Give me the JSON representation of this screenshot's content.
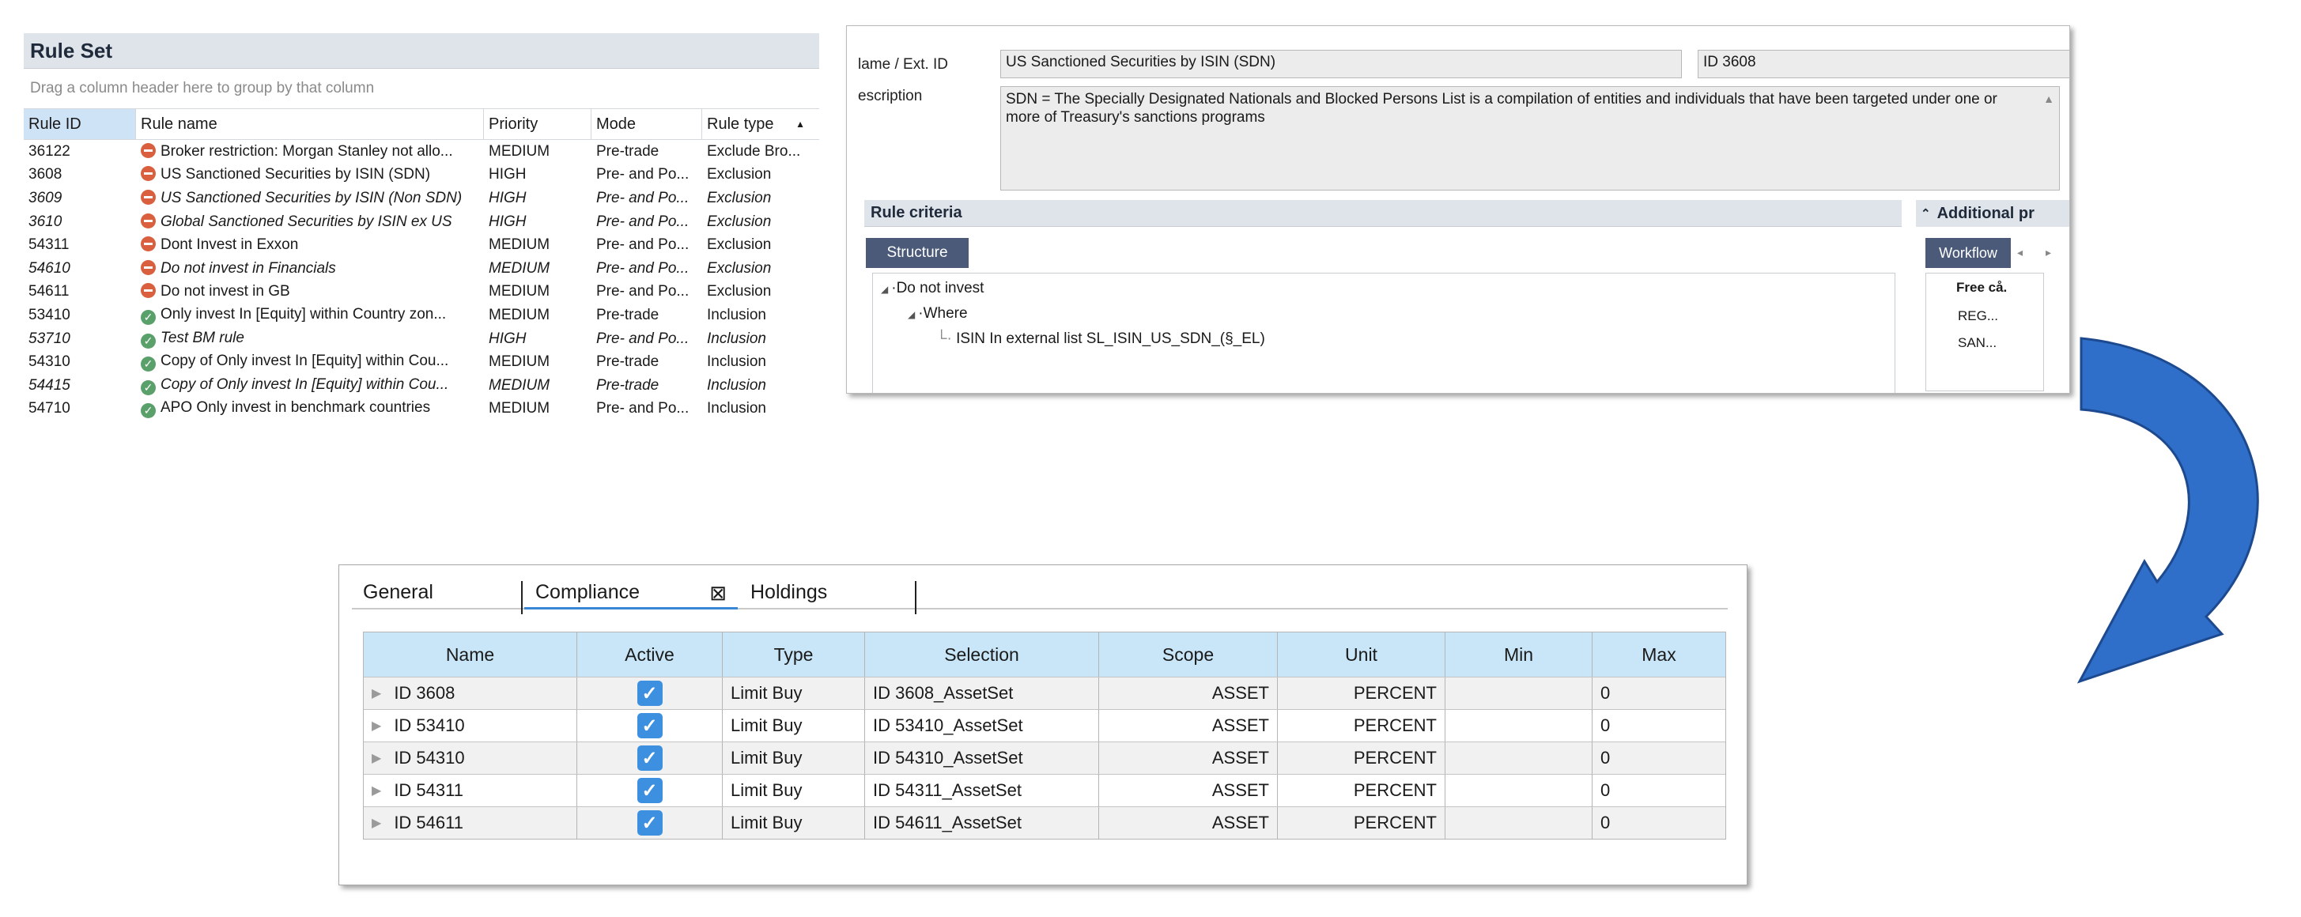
{
  "rule_set": {
    "title": "Rule Set",
    "group_hint": "Drag a column header here to group by that column",
    "columns": [
      "Rule ID",
      "Rule name",
      "Priority",
      "Mode",
      "Rule type"
    ],
    "rows": [
      {
        "id": "36122",
        "name": "Broker restriction: Morgan Stanley not allo...",
        "priority": "MEDIUM",
        "mode": "Pre-trade",
        "type": "Exclude Bro...",
        "status": "exclude"
      },
      {
        "id": "3608",
        "name": "US Sanctioned Securities by ISIN (SDN)",
        "priority": "HIGH",
        "mode": "Pre- and Po...",
        "type": "Exclusion",
        "status": "exclude"
      },
      {
        "id": "3609",
        "name": "US Sanctioned Securities by ISIN (Non SDN)",
        "priority": "HIGH",
        "mode": "Pre- and Po...",
        "type": "Exclusion",
        "status": "exclude"
      },
      {
        "id": "3610",
        "name": "Global Sanctioned Securities by ISIN ex US",
        "priority": "HIGH",
        "mode": "Pre- and Po...",
        "type": "Exclusion",
        "status": "exclude"
      },
      {
        "id": "54311",
        "name": "Dont Invest in Exxon",
        "priority": "MEDIUM",
        "mode": "Pre- and Po...",
        "type": "Exclusion",
        "status": "exclude"
      },
      {
        "id": "54610",
        "name": "Do not invest in Financials",
        "priority": "MEDIUM",
        "mode": "Pre- and Po...",
        "type": "Exclusion",
        "status": "exclude"
      },
      {
        "id": "54611",
        "name": "Do not invest in GB",
        "priority": "MEDIUM",
        "mode": "Pre- and Po...",
        "type": "Exclusion",
        "status": "exclude"
      },
      {
        "id": "53410",
        "name": "Only invest In [Equity] within Country zon...",
        "priority": "MEDIUM",
        "mode": "Pre-trade",
        "type": "Inclusion",
        "status": "include"
      },
      {
        "id": "53710",
        "name": "Test BM rule",
        "priority": "HIGH",
        "mode": "Pre- and Po...",
        "type": "Inclusion",
        "status": "include"
      },
      {
        "id": "54310",
        "name": "Copy of Only invest In [Equity] within Cou...",
        "priority": "MEDIUM",
        "mode": "Pre-trade",
        "type": "Inclusion",
        "status": "include"
      },
      {
        "id": "54415",
        "name": "Copy of Only invest In [Equity] within Cou...",
        "priority": "MEDIUM",
        "mode": "Pre-trade",
        "type": "Inclusion",
        "status": "include"
      },
      {
        "id": "54710",
        "name": "APO Only invest in benchmark countries",
        "priority": "MEDIUM",
        "mode": "Pre- and Po...",
        "type": "Inclusion",
        "status": "include"
      }
    ]
  },
  "rule_detail": {
    "name_label": "lame / Ext. ID",
    "name_value": "US Sanctioned Securities by ISIN (SDN)",
    "ext_id_value": "ID 3608",
    "description_label": "escription",
    "description_value": "SDN = The Specially Designated Nationals and Blocked Persons List is a compilation of entities and individuals that have been targeted under one or more of Treasury's sanctions programs",
    "criteria_title": "Rule criteria",
    "structure_tab": "Structure",
    "tree": [
      "Do not invest",
      "Where",
      "ISIN In external list SL_ISIN_US_SDN_(§_EL)"
    ],
    "additional_title": "Additional pr",
    "workflow_tab": "Workflow",
    "free_col_header": "Free cå.",
    "free_col_values": [
      "REG...",
      "SAN..."
    ]
  },
  "compliance": {
    "tabs": [
      "General",
      "Compliance",
      "Holdings"
    ],
    "active_tab": "Compliance",
    "columns": [
      "Name",
      "Active",
      "Type",
      "Selection",
      "Scope",
      "Unit",
      "Min",
      "Max"
    ],
    "rows": [
      {
        "name": "ID 3608",
        "active": true,
        "type": "Limit Buy",
        "selection": "ID 3608_AssetSet",
        "scope": "ASSET",
        "unit": "PERCENT",
        "min": "",
        "max": "0"
      },
      {
        "name": "ID 53410",
        "active": true,
        "type": "Limit Buy",
        "selection": "ID 53410_AssetSet",
        "scope": "ASSET",
        "unit": "PERCENT",
        "min": "",
        "max": "0"
      },
      {
        "name": "ID 54310",
        "active": true,
        "type": "Limit Buy",
        "selection": "ID 54310_AssetSet",
        "scope": "ASSET",
        "unit": "PERCENT",
        "min": "",
        "max": "0"
      },
      {
        "name": "ID 54311",
        "active": true,
        "type": "Limit Buy",
        "selection": "ID 54311_AssetSet",
        "scope": "ASSET",
        "unit": "PERCENT",
        "min": "",
        "max": "0"
      },
      {
        "name": "ID 54611",
        "active": true,
        "type": "Limit Buy",
        "selection": "ID 54611_AssetSet",
        "scope": "ASSET",
        "unit": "PERCENT",
        "min": "",
        "max": "0"
      }
    ]
  },
  "colors": {
    "arrow_fill": "#2f6fc9",
    "arrow_stroke": "#1d4a8f",
    "header_blue": "#c8e6f8",
    "checkbox": "#3d8fe0"
  }
}
